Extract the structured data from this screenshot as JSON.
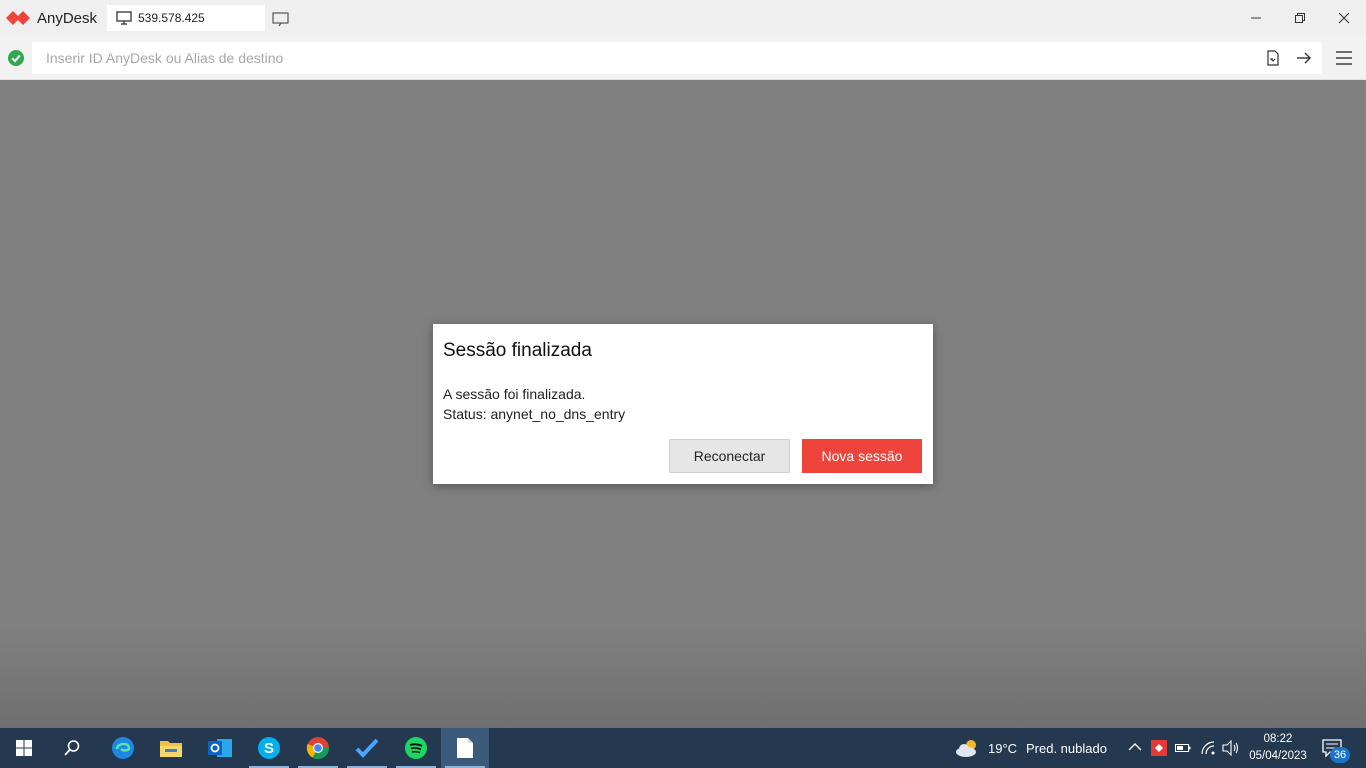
{
  "app": {
    "name": "AnyDesk"
  },
  "tab": {
    "address": "539.578.425"
  },
  "address_bar": {
    "placeholder": "Inserir ID AnyDesk ou Alias de destino",
    "value": ""
  },
  "dialog": {
    "title": "Sessão finalizada",
    "message_line1": "A sessão foi finalizada.",
    "message_line2": "Status: anynet_no_dns_entry",
    "reconnect_label": "Reconectar",
    "new_session_label": "Nova sessão"
  },
  "taskbar": {
    "apps": [
      "start-icon",
      "search-icon",
      "edge-icon",
      "file-explorer-icon",
      "outlook-icon",
      "skype-icon",
      "chrome-icon",
      "todo-icon",
      "spotify-icon",
      "notepad-icon"
    ],
    "weather_temp": "19°C",
    "weather_desc": "Pred. nublado",
    "time": "08:22",
    "date": "05/04/2023",
    "notification_count": "36"
  },
  "colors": {
    "accent": "#ef443b",
    "taskbar": "#24384f",
    "background": "#808080"
  }
}
